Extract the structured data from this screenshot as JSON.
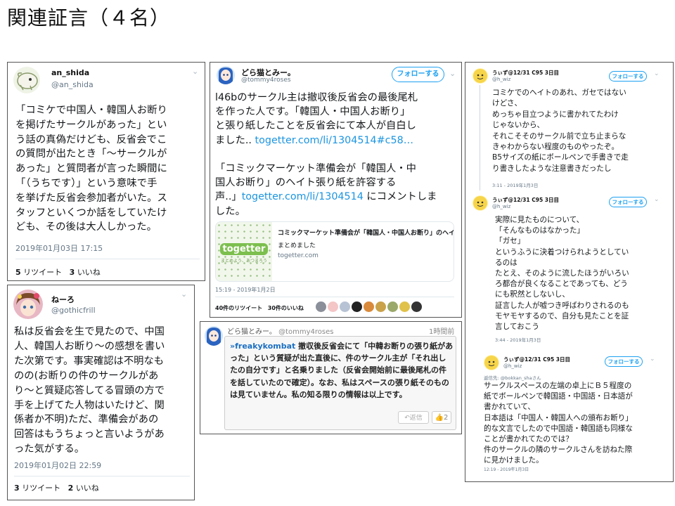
{
  "page": {
    "title": "関連証言（４名）"
  },
  "tweet1": {
    "name": "an_shida",
    "handle": "@an_shida",
    "body": "「コミケで中国人・韓国人お断り\nを掲げたサークルがあった」とい\nう話の真偽だけども、反省会でこ\nの質問が出たとき「〜サークルが\nあった」と質問者が言った瞬間に\n「（うちです）」という意味で手\nを挙げた反省会参加者がいた。ス\nタッフといくつか話をしていたけ\nども、その後は大人しかった。",
    "date": "2019年01月03日 17:15",
    "retweets": "5",
    "retweets_label": "リツイート",
    "likes": "3",
    "likes_label": "いいね"
  },
  "tweet2": {
    "name": "ねーろ",
    "handle": "@gothicfrill",
    "body": "私は反省会を生で見たので、中国\n人、韓国人お断り〜の感想を書い\nた次第です。事実確認は不明なも\nのの(お断りの件のサークルがあ\nり〜と質疑応答してる冒頭の方で\n手を上げてた人物はいたけど、関\n係者か不明)ただ、準備会があの\n回答はもうちょっと言いようがあ\nった気がする。",
    "date": "2019年01月02日 22:59",
    "retweets": "3",
    "retweets_label": "リツイート",
    "likes": "2",
    "likes_label": "いいね"
  },
  "tweet3": {
    "name": "どら猫とみー。",
    "handle": "@tommy4roses",
    "follow_label": "フォローする",
    "body_a": "l46bのサークル主は撤収後反省会の最後尾札\nを作った人です。「韓国人・中国人お断り」\nと張り紙したことを反省会にて本人が自白し\nました.. ",
    "link_a": "togetter.com/li/1304514#c58…",
    "body_b": "「コミックマーケット準備会が「韓国人・中\n国人お断り」のヘイト張り紙を許容する\n声..」",
    "link_b": "togetter.com/li/1304514",
    "body_c": " にコメントしま\nした。",
    "card_title": "コミックマーケット準備会が「韓国人・中国人お断り」のヘイ…",
    "card_desc": "まとめました",
    "card_domain": "togetter.com",
    "card_logo": "togetter",
    "card_slogan": "まとめよう、あつまろう",
    "date": "15:19 - 2019年1月2日",
    "retweets": "40件のリツイート",
    "likes": "30件のいいね"
  },
  "tweet4": {
    "name": "どら猫とみー。",
    "handle": "@tommy4roses",
    "time": "1時間前",
    "reply_to": "»freakykombat",
    "body": " 撤収後反省会にて「中韓お断りの張り紙があった」という質疑が出た直後に、件のサークル主が「それ出したの自分です」と名乗りました（反省会開始前に最後尾札の件を話していたので確定）。なお、私はスペースの張り紙そのものは見ていません。私の知る限りの情報は以上です。",
    "reply_label": "返信",
    "like_count": "2"
  },
  "tweet5": {
    "name": "うぃず@12/31 C95 3日目",
    "handle": "@h_wiz",
    "follow_label": "フォローする",
    "body": "コミケでのヘイトのあれ、ガセではない\nけどさ、\nめっちゃ目立つように書かれてたわけ\nじゃないから、\nそれこそそのサークル前で立ち止まらな\nきゃわからない程度のものやったぞ。\nB5サイズの紙にボールペンで手書きで走\nり書きしたような注意書きだったし",
    "date": "3:11 - 2019年1月3日"
  },
  "tweet6": {
    "name": "うぃず@12/31 C95 3日目",
    "handle": "@h_wiz",
    "follow_label": "フォローする",
    "body": "実際に見たものについて、\n「そんなものはなかった」\n「ガセ」\nというふうに決着つけられようとしてい\nるのは\nたとえ、そのように流したほうがいろい\nろ都合が良くなることであっても、どう\nにも釈然としないし、\n証言した人が嘘つき呼ばわりされるのも\nモヤモヤするので、自分も見たことを証\n言しておこう",
    "date": "3:44 - 2019年1月3日"
  },
  "tweet7": {
    "name": "うぃず@12/31 C95 3日目",
    "handle": "@h_wiz",
    "follow_label": "フォローする",
    "reply_to": "返信先: @bokkan_shaさん",
    "body": "サークルスペースの左端の卓上にＢ５程度の\n紙でボールペンで韓国語・中国語・日本語が\n書かれていて、\n日本語は「中国人・韓国人への頒布お断り」\n的な文言でしたので中国語・韓国語も同様な\nことが書かれてたのでは？\n件のサークルの隣のサークルさんを訪ねた際\nに見かけました。",
    "date": "12:19 - 2019年1月3日"
  },
  "colors": {
    "link": "#1b95e0",
    "twitter_blue": "#1da1f2",
    "muted": "#657786"
  }
}
